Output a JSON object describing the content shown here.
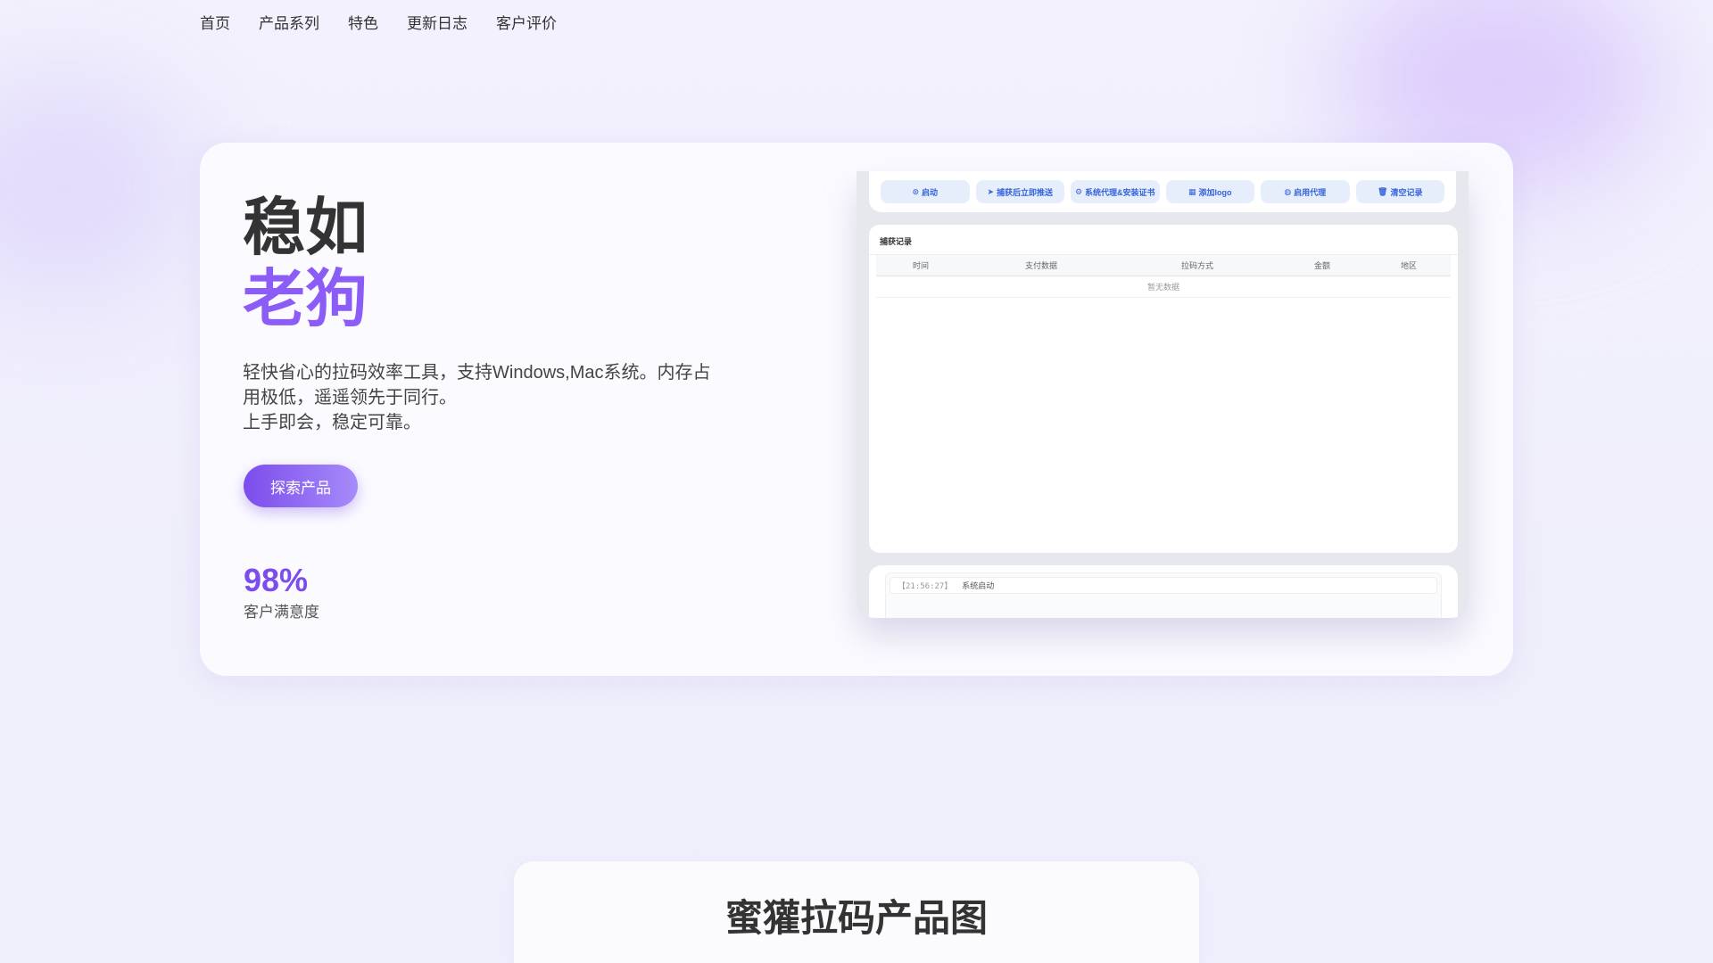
{
  "nav": [
    "首页",
    "产品系列",
    "特色",
    "更新日志",
    "客户评价"
  ],
  "hero": {
    "title_line1": "稳如",
    "title_line2": "老狗",
    "description": "轻快省心的拉码效率工具，支持Windows,Mac系统。内存占用极低，遥遥领先于同行。",
    "description2": "上手即会，稳定可靠。",
    "cta": "探索产品",
    "stat_value": "98%",
    "stat_label": "客户满意度"
  },
  "app": {
    "toolbar": [
      {
        "label": "启动",
        "icon": "power-icon"
      },
      {
        "label": "捕获后立即推送",
        "icon": "send-icon"
      },
      {
        "label": "系统代理&安装证书",
        "icon": "gear-icon"
      },
      {
        "label": "添加logo",
        "icon": "image-icon"
      },
      {
        "label": "启用代理",
        "icon": "globe-icon"
      },
      {
        "label": "清空记录",
        "icon": "trash-icon"
      }
    ],
    "records_title": "捕获记录",
    "columns": [
      "时间",
      "支付数据",
      "拉码方式",
      "金额",
      "地区"
    ],
    "empty": "暂无数据",
    "log": {
      "time": "【21:56:27】",
      "message": "系统启动"
    }
  },
  "section": {
    "title": "蜜獾拉码产品图"
  },
  "colors": {
    "accent": "#8b5cf6",
    "button_blue": "#3563d9"
  }
}
